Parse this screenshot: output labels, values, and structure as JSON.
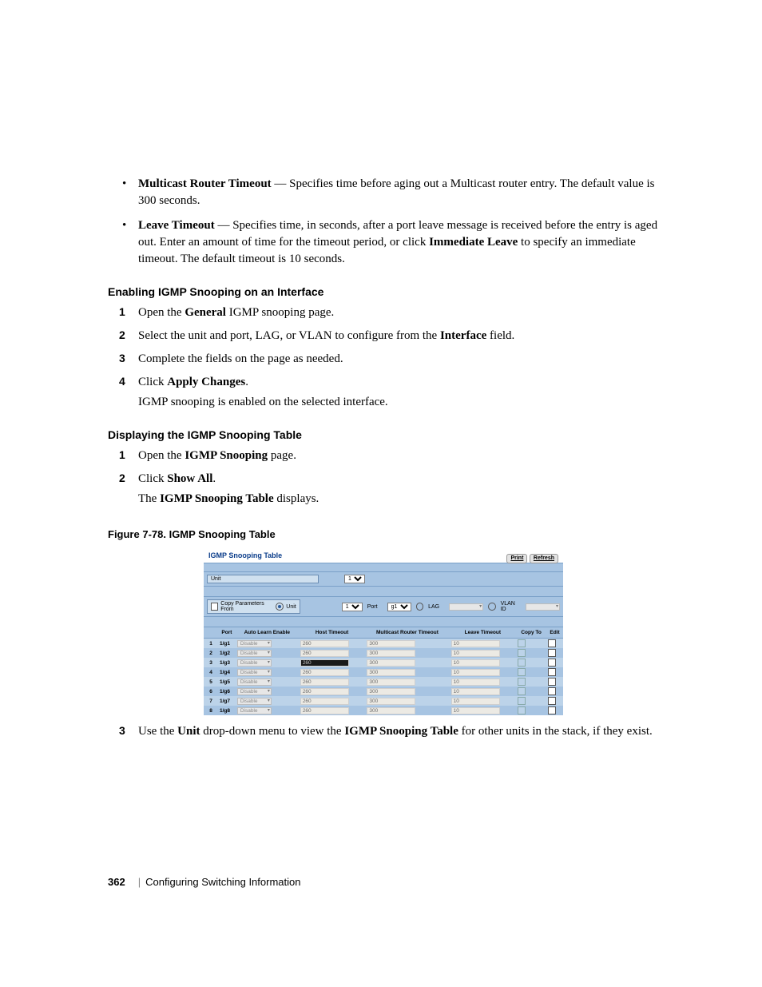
{
  "bullets": [
    {
      "termBold": "Multicast Router Timeout",
      "sep": " — ",
      "text": "Specifies time before aging out a Multicast router entry. The default value is 300 seconds."
    },
    {
      "termBold": "Leave Timeout",
      "sep": " — ",
      "text_a": "Specifies time, in seconds, after a port leave message is received before the entry is aged out. Enter an amount of time for the timeout period, or click ",
      "text_bold": "Immediate Leave",
      "text_b": " to specify an immediate timeout. The default timeout is 10 seconds."
    }
  ],
  "sec1_heading": "Enabling IGMP Snooping on an Interface",
  "sec1_steps": [
    {
      "n": "1",
      "pre": "Open the ",
      "bold": "General",
      "post": " IGMP snooping page."
    },
    {
      "n": "2",
      "pre": "Select the unit and port, LAG, or VLAN to configure from the ",
      "bold": "Interface",
      "post": " field."
    },
    {
      "n": "3",
      "pre": "Complete the fields on the page as needed.",
      "bold": "",
      "post": ""
    },
    {
      "n": "4",
      "pre": "Click ",
      "bold": "Apply Changes",
      "post": ".",
      "follow": "IGMP snooping is enabled on the selected interface."
    }
  ],
  "sec2_heading": "Displaying the IGMP Snooping Table",
  "sec2_steps": [
    {
      "n": "1",
      "pre": "Open the ",
      "bold": "IGMP Snooping",
      "post": " page."
    },
    {
      "n": "2",
      "pre": "Click ",
      "bold": "Show All",
      "post": ".",
      "follow_pre": "The ",
      "follow_bold": "IGMP Snooping Table",
      "follow_post": " displays."
    }
  ],
  "figure_caption": "Figure 7-78.    IGMP Snooping Table",
  "shot": {
    "title": "IGMP Snooping Table",
    "print": "Print",
    "refresh": "Refresh",
    "unit_label": "Unit",
    "unit_value": "1",
    "cpf_label": "Copy Parameters From",
    "cpf_unit_label": "Unit",
    "cpf_unit_value": "1",
    "port_label": "Port",
    "port_value": "g1",
    "lag_label": "LAG",
    "vlan_label": "VLAN ID",
    "headers": {
      "port": "Port",
      "auto": "Auto Learn Enable",
      "host": "Host Timeout",
      "mrt": "Multicast Router Timeout",
      "leave": "Leave Timeout",
      "copyto": "Copy To",
      "edit": "Edit"
    },
    "rows": [
      {
        "i": "1",
        "port": "1/g1",
        "auto": "Disable",
        "host": "260",
        "mrt": "300",
        "leave": "10"
      },
      {
        "i": "2",
        "port": "1/g2",
        "auto": "Disable",
        "host": "260",
        "mrt": "300",
        "leave": "10"
      },
      {
        "i": "3",
        "port": "1/g3",
        "auto": "Disable",
        "host": "260",
        "mrt": "300",
        "leave": "10",
        "dark": true
      },
      {
        "i": "4",
        "port": "1/g4",
        "auto": "Disable",
        "host": "260",
        "mrt": "300",
        "leave": "10"
      },
      {
        "i": "5",
        "port": "1/g5",
        "auto": "Disable",
        "host": "260",
        "mrt": "300",
        "leave": "10"
      },
      {
        "i": "6",
        "port": "1/g6",
        "auto": "Disable",
        "host": "260",
        "mrt": "300",
        "leave": "10"
      },
      {
        "i": "7",
        "port": "1/g7",
        "auto": "Disable",
        "host": "260",
        "mrt": "300",
        "leave": "10"
      },
      {
        "i": "8",
        "port": "1/g8",
        "auto": "Disable",
        "host": "260",
        "mrt": "300",
        "leave": "10"
      }
    ]
  },
  "step3": {
    "n": "3",
    "pre": "Use the ",
    "bold1": "Unit",
    "mid": " drop-down menu to view the ",
    "bold2": "IGMP Snooping Table",
    "post": " for other units in the stack, if they exist."
  },
  "footer": {
    "page": "362",
    "section": "Configuring Switching Information"
  }
}
